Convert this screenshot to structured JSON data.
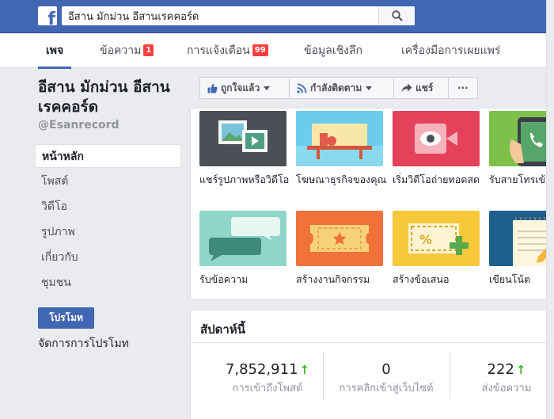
{
  "search": {
    "value": "อีสาน มักม่วน อีสานเรคคอร์ด"
  },
  "page_nav": [
    {
      "label": "เพจ",
      "badge": ""
    },
    {
      "label": "ข้อความ",
      "badge": "1"
    },
    {
      "label": "การแจ้งเตือน",
      "badge": "99"
    },
    {
      "label": "ข้อมูลเชิงลึก",
      "badge": ""
    },
    {
      "label": "เครื่องมือการเผยแพร่",
      "badge": ""
    }
  ],
  "page": {
    "name": "อีสาน มักม่วน อีสานเรคคอร์ด",
    "handle": "@Esanrecord"
  },
  "left_nav": [
    "หน้าหลัก",
    "โพสต์",
    "วิดีโอ",
    "รูปภาพ",
    "เกี่ยวกับ",
    "ชุมชน"
  ],
  "promote": {
    "button": "โปรโมท",
    "manage": "จัดการการโปรโมท"
  },
  "actions": {
    "like": "ถูกใจแล้ว",
    "follow": "กำลังติดตาม",
    "share": "แชร์",
    "more": "···"
  },
  "tiles": [
    {
      "label": "แชร์รูปภาพหรือวิดีโอ",
      "icon": "photo-video-icon",
      "color": "#4b4f56"
    },
    {
      "label": "โฆษณาธุรกิจของคุณ",
      "icon": "storefront-icon",
      "color": "#6bcde9"
    },
    {
      "label": "เริ่มวิดีโอถ่ายทอดสด",
      "icon": "live-video-icon",
      "color": "#e4415a"
    },
    {
      "label": "รับสายโทรเข้า",
      "icon": "phone-call-icon",
      "color": "#7dc14b"
    },
    {
      "label": "รับข้อความ",
      "icon": "chat-bubbles-icon",
      "color": "#8fd6c8"
    },
    {
      "label": "สร้างงานกิจกรรม",
      "icon": "event-ticket-icon",
      "color": "#f07139"
    },
    {
      "label": "สร้างข้อเสนอ",
      "icon": "offer-coupon-icon",
      "color": "#f6c83c"
    },
    {
      "label": "เขียนโน้ต",
      "icon": "note-pencil-icon",
      "color": "#1f5f8b"
    }
  ],
  "weekly": {
    "title": "สัปดาห์นี้",
    "stats": [
      {
        "value": "7,852,911",
        "label": "การเข้าถึงโพสต์",
        "up": true
      },
      {
        "value": "0",
        "label": "การคลิกเข้าสู่เว็บไซต์",
        "up": false
      },
      {
        "value": "222",
        "label": "ส่งข้อความ",
        "up": true
      }
    ]
  }
}
